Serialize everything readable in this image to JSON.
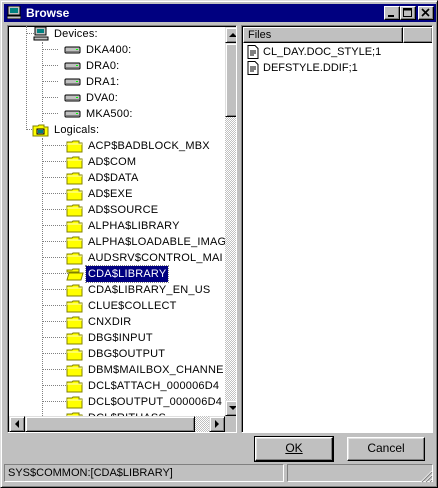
{
  "window": {
    "title": "Browse",
    "titlebar_color": "#000080",
    "controls": [
      "minimize-icon",
      "maximize-icon",
      "close-icon"
    ]
  },
  "tree": {
    "devices_label": "Devices:",
    "devices": [
      "DKA400:",
      "DRA0:",
      "DRA1:",
      "DVA0:",
      "MKA500:"
    ],
    "logicals_label": "Logicals:",
    "logicals": [
      "ACP$BADBLOCK_MBX",
      "AD$COM",
      "AD$DATA",
      "AD$EXE",
      "AD$SOURCE",
      "ALPHA$LIBRARY",
      "ALPHA$LOADABLE_IMAG",
      "AUDSRV$CONTROL_MAI",
      "CDA$LIBRARY",
      "CDA$LIBRARY_EN_US",
      "CLUE$COLLECT",
      "CNXDIR",
      "DBG$INPUT",
      "DBG$OUTPUT",
      "DBM$MAILBOX_CHANNE",
      "DCL$ATTACH_000006D4",
      "DCL$OUTPUT_000006D4",
      "DCL$RITHASS"
    ],
    "selected": "CDA$LIBRARY"
  },
  "files": {
    "header": "Files",
    "items": [
      "CL_DAY.DOC_STYLE;1",
      "DEFSTYLE.DDIF;1"
    ]
  },
  "buttons": {
    "ok_label": "OK",
    "cancel_label": "Cancel"
  },
  "status": {
    "path": "SYS$COMMON:[CDA$LIBRARY]"
  }
}
